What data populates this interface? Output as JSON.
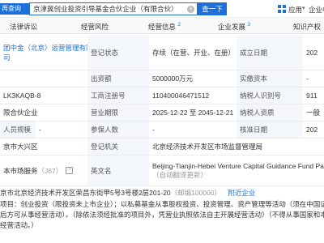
{
  "topbar": {
    "left_label": "再查询",
    "search_value": "京津冀创业投资引导基金合伙企业（有限合伙）",
    "search_button": "查一下",
    "app_label": "应用",
    "right_label": "企业中"
  },
  "tabs": [
    {
      "label": "法律诉讼",
      "count": ""
    },
    {
      "label": "经营风险",
      "count": ""
    },
    {
      "label": "经营信息",
      "count": "2"
    },
    {
      "label": "企业发展",
      "count": "3"
    },
    {
      "label": "知识产权",
      "count": ""
    }
  ],
  "info": {
    "r1": {
      "c0": "团中金（北京）运营管理有限",
      "c0b": "司",
      "lbl1": "登记状态",
      "val1": "存续（在营、开业、在册）",
      "lbl2": "成立日期",
      "val2": "202"
    },
    "r2": {
      "lbl1": "出资额",
      "val1": "5000000万元",
      "lbl2": "实缴资本",
      "val2": "-"
    },
    "r3": {
      "c0": "LK3KAQB-8",
      "lbl1": "工商注册号",
      "val1": "110400046471512",
      "lbl2": "纳税人识别号",
      "val2": "911"
    },
    "r4": {
      "c0": "限合伙企业",
      "lbl1": "营业期限",
      "val1": "2025-12-22 至 2045-12-21",
      "lbl2": "纳税人资质",
      "val2": "一般"
    },
    "r5": {
      "lbl1": "人员规模",
      "val1": "-",
      "lbl2": "参保人数",
      "val2": "-",
      "lbl3": "核准日期",
      "val3": "202"
    },
    "r6": {
      "c0": "京市大兴区",
      "lbl1": "登记机关",
      "val1": "北京经济技术开发区市场监督管理局"
    },
    "r7": {
      "c0": "本市场服务",
      "c0b": "（J67）",
      "lbl1": "英文名",
      "val1": "Beijing-Tianjin-Hebei Venture Capital Guidance Fund Partn",
      "val1b": "（自动翻译更新）"
    }
  },
  "address": {
    "text": "京市北京经济技术开发区荣昌东街甲5号3号楼2层201-20",
    "zip": "（邮编100000）",
    "link": "附近企业"
  },
  "scope": [
    "项目：创业投资（限投资未上市企业）；以私募基金从事股权投资、投资管理、资产管理等活动（须在中国证券",
    "后方可从事经营活动）。（除依法须经批准的项目外，凭营业执照依法自主开展经营活动）（不得从事国家和本市",
    "经营活动。）"
  ]
}
